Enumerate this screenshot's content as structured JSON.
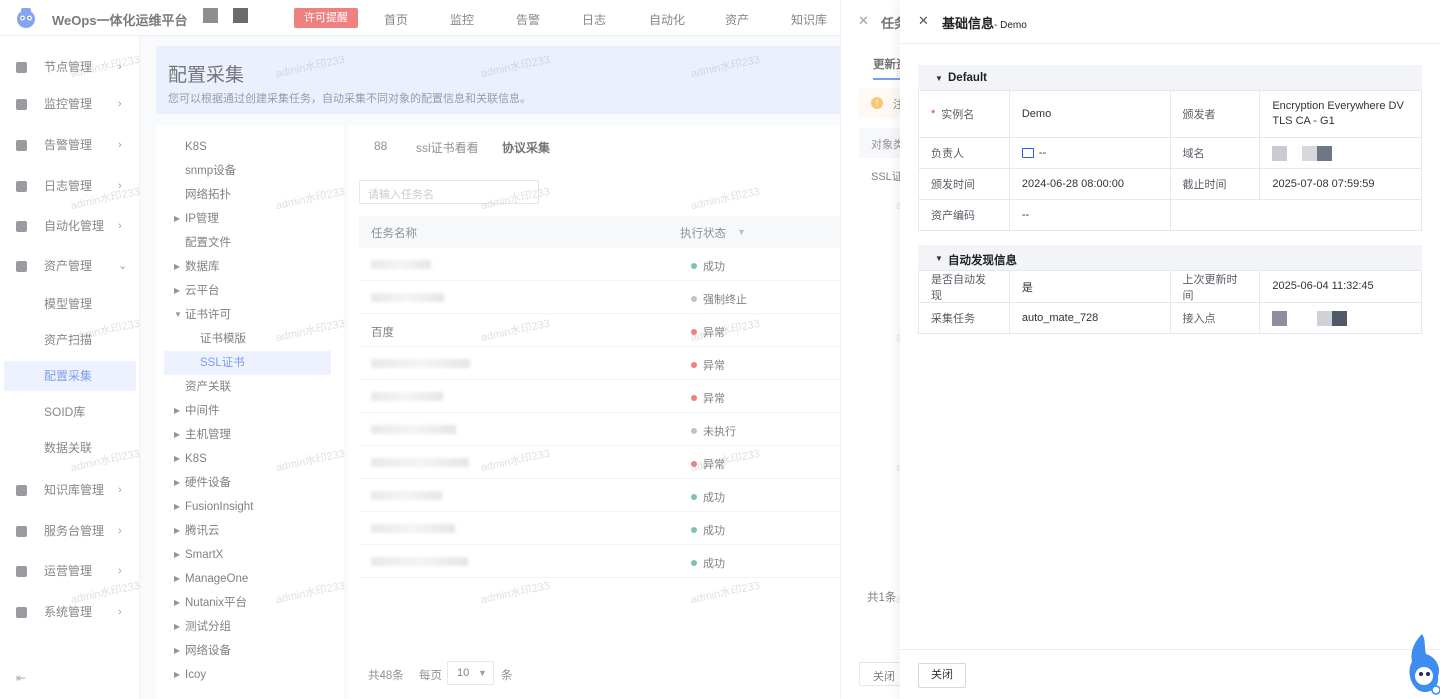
{
  "app": {
    "title": "WeOps一体化运维平台",
    "license_badge": "许可提醒",
    "nav": [
      "首页",
      "监控",
      "告警",
      "日志",
      "自动化",
      "资产",
      "知识库"
    ]
  },
  "sidebar": {
    "items": [
      {
        "label": "节点管理"
      },
      {
        "label": "监控管理"
      },
      {
        "label": "告警管理"
      },
      {
        "label": "日志管理"
      },
      {
        "label": "自动化管理"
      },
      {
        "label": "资产管理"
      }
    ],
    "sub_items": [
      {
        "label": "模型管理"
      },
      {
        "label": "资产扫描"
      },
      {
        "label": "配置采集"
      },
      {
        "label": "SOID库"
      },
      {
        "label": "数据关联"
      }
    ],
    "items_after": [
      {
        "label": "知识库管理"
      },
      {
        "label": "服务台管理"
      },
      {
        "label": "运营管理"
      },
      {
        "label": "系统管理"
      }
    ]
  },
  "banner": {
    "title": "配置采集",
    "desc": "您可以根据通过创建采集任务，自动采集不同对象的配置信息和关联信息。"
  },
  "tree": [
    "K8S",
    "snmp设备",
    "网络拓扑",
    "IP管理",
    "配置文件",
    "数据库",
    "云平台",
    "证书许可",
    "证书模版",
    "SSL证书",
    "资产关联",
    "中间件",
    "主机管理",
    "K8S",
    "硬件设备",
    "FusionInsight",
    "腾讯云",
    "SmartX",
    "ManageOne",
    "Nutanix平台",
    "测试分组",
    "网络设备",
    "Icoy"
  ],
  "tabs": [
    "88",
    "ssl证书看看",
    "协议采集"
  ],
  "search": {
    "placeholder": "请输入任务名"
  },
  "table": {
    "headers": [
      "任务名称",
      "执行状态"
    ],
    "rows": [
      {
        "name": "",
        "status": "成功"
      },
      {
        "name": "",
        "status": "强制终止"
      },
      {
        "name": "百度",
        "status": "异常"
      },
      {
        "name": "",
        "status": "异常"
      },
      {
        "name": "",
        "status": "异常"
      },
      {
        "name": "",
        "status": "未执行"
      },
      {
        "name": "",
        "status": "异常"
      },
      {
        "name": "",
        "status": "成功"
      },
      {
        "name": "",
        "status": "成功"
      },
      {
        "name": "",
        "status": "成功"
      }
    ]
  },
  "pager": {
    "total": "共48条",
    "per_page_label": "每页",
    "per_page": "10",
    "unit": "条"
  },
  "drawer1": {
    "title": "任务",
    "tab": "更新资",
    "alert": "注",
    "th": "对象类",
    "td": "SSL证",
    "count": "共1条",
    "close": "关闭"
  },
  "drawer2": {
    "title": "基础信息",
    "subtitle": "- Demo",
    "section1": "Default",
    "rows1": [
      {
        "k1": "实例名",
        "v1": "Demo",
        "k2": "颁发者",
        "v2": "Encryption Everywhere DV TLS CA - G1"
      },
      {
        "k1": "负责人",
        "v1": "--",
        "k2": "域名",
        "v2": ""
      },
      {
        "k1": "颁发时间",
        "v1": "2024-06-28 08:00:00",
        "k2": "截止时间",
        "v2": "2025-07-08 07:59:59"
      },
      {
        "k1": "资产编码",
        "v1": "--",
        "k2": "",
        "v2": ""
      }
    ],
    "section2": "自动发现信息",
    "rows2": [
      {
        "k1": "是否自动发现",
        "v1": "是",
        "k2": "上次更新时间",
        "v2": "2025-06-04 11:32:45"
      },
      {
        "k1": "采集任务",
        "v1": "auto_mate_728",
        "k2": "接入点",
        "v2": ""
      }
    ],
    "close": "关闭"
  },
  "watermark": "admin水印233",
  "colors": {
    "primary": "#2c61e6",
    "success": "#2ba471",
    "error": "#e53333",
    "neutral": "#9aa0aa"
  }
}
